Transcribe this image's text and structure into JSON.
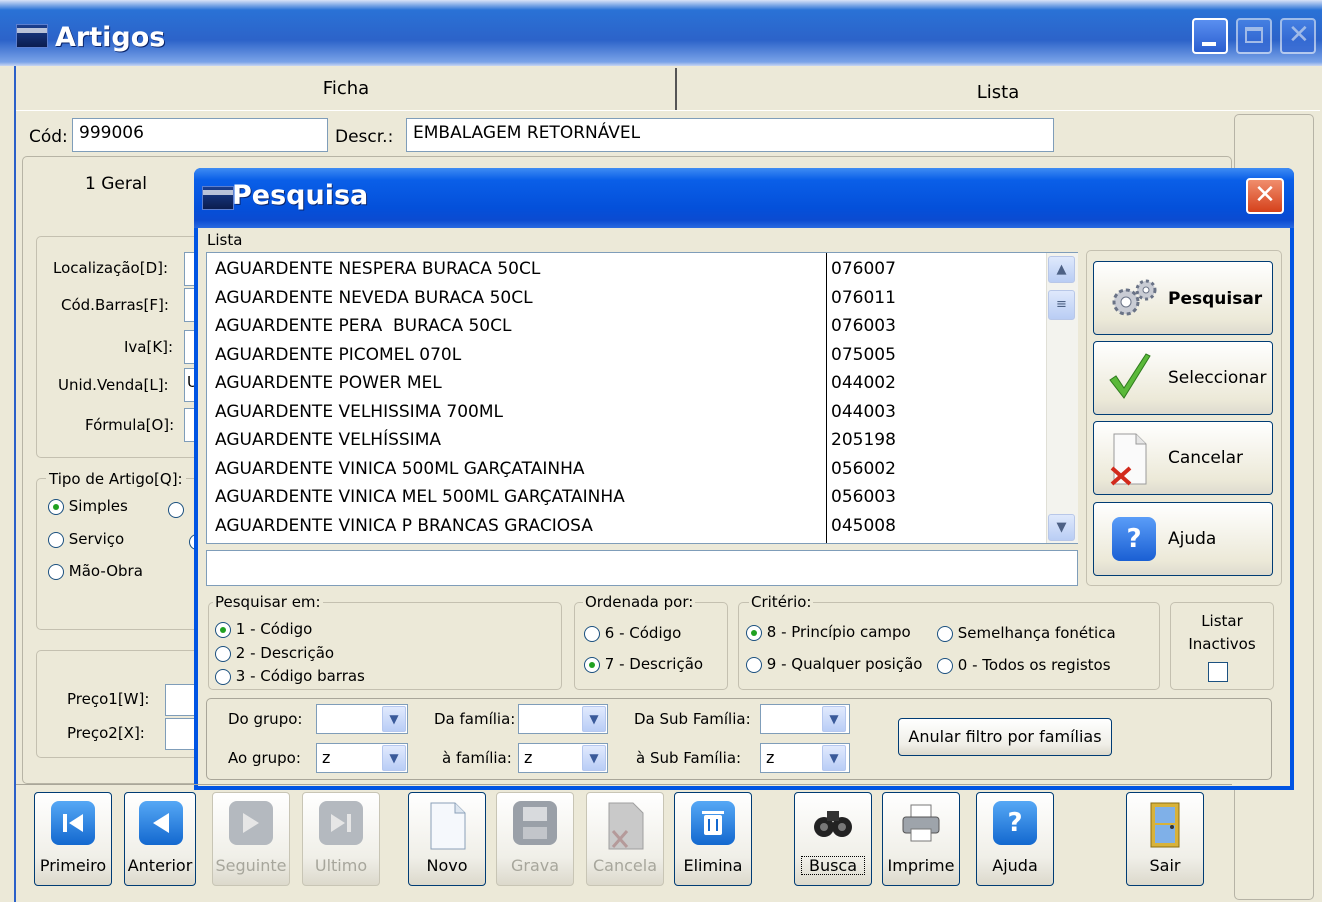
{
  "window": {
    "title": "Artigos"
  },
  "main_tabs": [
    {
      "label": "Ficha"
    },
    {
      "label": "Lista"
    }
  ],
  "header": {
    "cod_label": "Cód:",
    "cod_value": "999006",
    "descr_label": "Descr.:",
    "descr_value": "EMBALAGEM RETORNÁVEL"
  },
  "sub_tabs": [
    {
      "label": "1 Geral"
    }
  ],
  "form_labels": {
    "localizacao": "Localização[D]:",
    "cod_barras": "Cód.Barras[F]:",
    "iva": "Iva[K]:",
    "unid_venda": "Unid.Venda[L]:",
    "formula": "Fórmula[O]:",
    "preco1": "Preço1[W]:",
    "preco2": "Preço2[X]:"
  },
  "unid_venda_fragment": "U",
  "tipo_artigo": {
    "label": "Tipo de Artigo[Q]:",
    "options": [
      {
        "label": "Simples",
        "selected": true
      },
      {
        "label": "Serviço",
        "selected": false
      },
      {
        "label": "Mão-Obra",
        "selected": false
      }
    ]
  },
  "dialog": {
    "title": "Pesquisa",
    "list_label": "Lista",
    "rows": [
      {
        "descr": "AGUARDENTE NESPERA BURACA 50CL",
        "code": "076007"
      },
      {
        "descr": "AGUARDENTE NEVEDA BURACA 50CL",
        "code": "076011"
      },
      {
        "descr": "AGUARDENTE PERA  BURACA 50CL",
        "code": "076003"
      },
      {
        "descr": "AGUARDENTE PICOMEL 070L",
        "code": "075005"
      },
      {
        "descr": "AGUARDENTE POWER MEL",
        "code": "044002"
      },
      {
        "descr": "AGUARDENTE VELHISSIMA 700ML",
        "code": "044003"
      },
      {
        "descr": "AGUARDENTE VELHÍSSIMA",
        "code": "205198"
      },
      {
        "descr": "AGUARDENTE VINICA 500ML GARÇATAINHA",
        "code": "056002"
      },
      {
        "descr": "AGUARDENTE VINICA MEL 500ML GARÇATAINHA",
        "code": "056003"
      },
      {
        "descr": "AGUARDENTE VINICA P BRANCAS GRACIOSA",
        "code": "045008"
      }
    ],
    "search_value": "",
    "buttons": {
      "pesquisar": "Pesquisar",
      "seleccionar": "Seleccionar",
      "cancelar": "Cancelar",
      "ajuda": "Ajuda"
    },
    "pesquisar_em": {
      "label": "Pesquisar em:",
      "options": [
        {
          "label": "1 - Código",
          "selected": true
        },
        {
          "label": "2 - Descrição",
          "selected": false
        },
        {
          "label": "3 - Código barras",
          "selected": false
        }
      ]
    },
    "ordenada_por": {
      "label": "Ordenada por:",
      "options": [
        {
          "label": "6 - Código",
          "selected": false
        },
        {
          "label": "7 - Descrição",
          "selected": true
        }
      ]
    },
    "criterio": {
      "label": "Critério:",
      "options": [
        {
          "label": "8 - Princípio campo",
          "selected": true
        },
        {
          "label": "Semelhança fonética",
          "selected": false
        },
        {
          "label": "9 - Qualquer posição",
          "selected": false
        },
        {
          "label": "0 - Todos os registos",
          "selected": false
        }
      ]
    },
    "listar_inactivos": {
      "label_line1": "Listar",
      "label_line2": "Inactivos",
      "checked": false
    },
    "filters": {
      "do_grupo": {
        "label": "Do grupo:",
        "value": ""
      },
      "ao_grupo": {
        "label": "Ao grupo:",
        "value": "z"
      },
      "da_familia": {
        "label": "Da família:",
        "value": ""
      },
      "a_familia": {
        "label": "à família:",
        "value": "z"
      },
      "da_sub_familia": {
        "label": "Da Sub Família:",
        "value": ""
      },
      "a_sub_familia": {
        "label": "à Sub Família:",
        "value": "z"
      },
      "anular": "Anular filtro por famílias"
    }
  },
  "toolbar": [
    {
      "label": "Primeiro",
      "enabled": true
    },
    {
      "label": "Anterior",
      "enabled": true
    },
    {
      "label": "Seguinte",
      "enabled": false
    },
    {
      "label": "Ultimo",
      "enabled": false
    },
    {
      "label": "Novo",
      "enabled": true
    },
    {
      "label": "Grava",
      "enabled": false
    },
    {
      "label": "Cancela",
      "enabled": false
    },
    {
      "label": "Elimina",
      "enabled": true
    },
    {
      "label": "Busca",
      "enabled": true
    },
    {
      "label": "Imprime",
      "enabled": true
    },
    {
      "label": "Ajuda",
      "enabled": true
    },
    {
      "label": "Sair",
      "enabled": true
    }
  ],
  "colors": {
    "xp_blue": "#0054e3",
    "face": "#ece9d8",
    "accent_green": "#21a121",
    "close_red": "#d5411b"
  }
}
